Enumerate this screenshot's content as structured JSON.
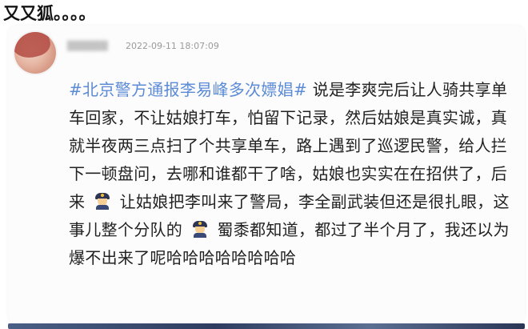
{
  "header": {
    "top_text": "又又狐。。。。"
  },
  "post": {
    "timestamp": "2022-09-11 18:07:09",
    "hashtag": "#北京警方通报李易峰多次嫖娼#",
    "text_part_1": "说是李爽完后让人骑共享单车回家，不让姑娘打车，怕留下记录，然后姑娘是真实诚，真就半夜两三点扫了个共享单车，路上遇到了巡逻民警，给人拦下一顿盘问，去哪和谁都干了啥，姑娘也实实在在招供了，后来",
    "text_part_2": "让姑娘把李叫来了警局，李全副武装但还是很扎眼，这事儿整个分队的",
    "text_part_3": "蜀黍都知道，都过了半个月了，我还以为爆不出来了呢哈哈哈哈哈哈哈哈",
    "icons": [
      "police-officer-icon",
      "police-officer-icon"
    ]
  }
}
